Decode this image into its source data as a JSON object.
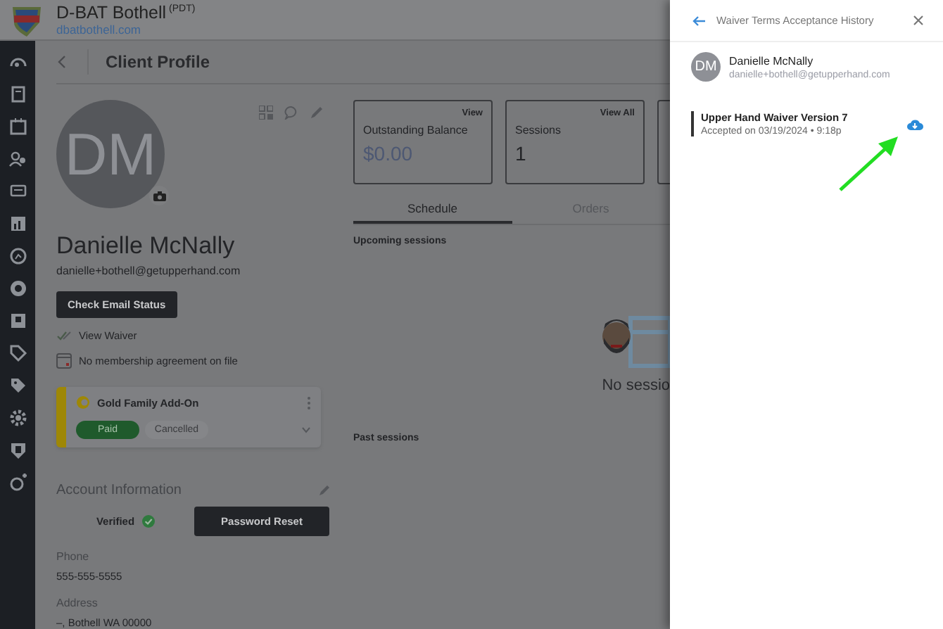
{
  "header": {
    "business_name": "D-BAT Bothell",
    "timezone": "(PDT)",
    "website": "dbatbothell.com"
  },
  "page": {
    "title": "Client Profile"
  },
  "client": {
    "initials": "DM",
    "name": "Danielle McNally",
    "email": "danielle+bothell@getupperhand.com",
    "check_email_button": "Check Email Status",
    "view_waiver": "View Waiver",
    "membership_note": "No membership agreement on file"
  },
  "membership_card": {
    "name": "Gold Family Add-On",
    "badges": [
      {
        "label": "Paid",
        "kind": "paid"
      },
      {
        "label": "Cancelled",
        "kind": "cancelled"
      }
    ]
  },
  "account": {
    "title": "Account Information",
    "verified": "Verified",
    "password_reset": "Password Reset",
    "fields": [
      {
        "label": "Phone",
        "value": "555-555-5555"
      },
      {
        "label": "Address",
        "value": "–, Bothell WA 00000"
      }
    ]
  },
  "summary_cards": [
    {
      "link": "View",
      "label": "Outstanding Balance",
      "value": "$0.00",
      "kind": "money"
    },
    {
      "link": "View All",
      "label": "Sessions",
      "value": "1",
      "kind": "count"
    }
  ],
  "tabs": [
    {
      "label": "Schedule",
      "selected": true
    },
    {
      "label": "Orders",
      "selected": false
    }
  ],
  "schedule": {
    "upcoming_heading": "Upcoming sessions",
    "empty_message": "No sessio",
    "past_heading": "Past sessions"
  },
  "drawer": {
    "title": "Waiver Terms Acceptance History",
    "client": {
      "initials": "DM",
      "name": "Danielle McNally",
      "email": "danielle+bothell@getupperhand.com"
    },
    "waivers": [
      {
        "title": "Upper Hand Waiver Version 7",
        "accepted": "Accepted on 03/19/2024 • 9:18p"
      }
    ]
  }
}
